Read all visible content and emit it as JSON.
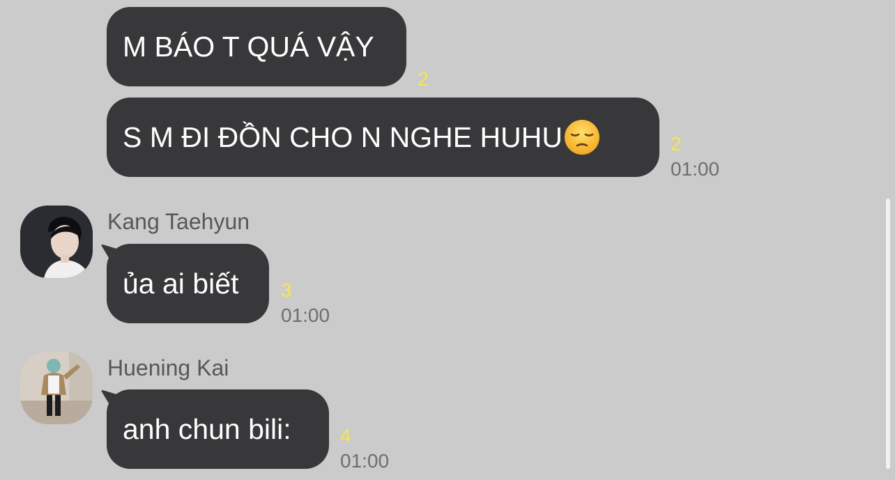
{
  "messages": [
    {
      "text": "M BÁO T QUÁ VẬY",
      "read_count": "2",
      "time": ""
    },
    {
      "text": "S M ĐI ĐỒN CHO N NGHE HUHU",
      "emoji": "pensive-face",
      "read_count": "2",
      "time": "01:00"
    },
    {
      "sender": "Kang Taehyun",
      "text": "ủa ai biết",
      "read_count": "3",
      "time": "01:00"
    },
    {
      "sender": "Huening Kai",
      "text": "anh chun bili:",
      "read_count": "4",
      "time": "01:00"
    }
  ],
  "colors": {
    "background": "#cbcbcb",
    "bubble": "#38383a",
    "bubble_text": "#ffffff",
    "read_count": "#f7e84a",
    "time": "#6e6e70",
    "sender": "#57575a"
  }
}
